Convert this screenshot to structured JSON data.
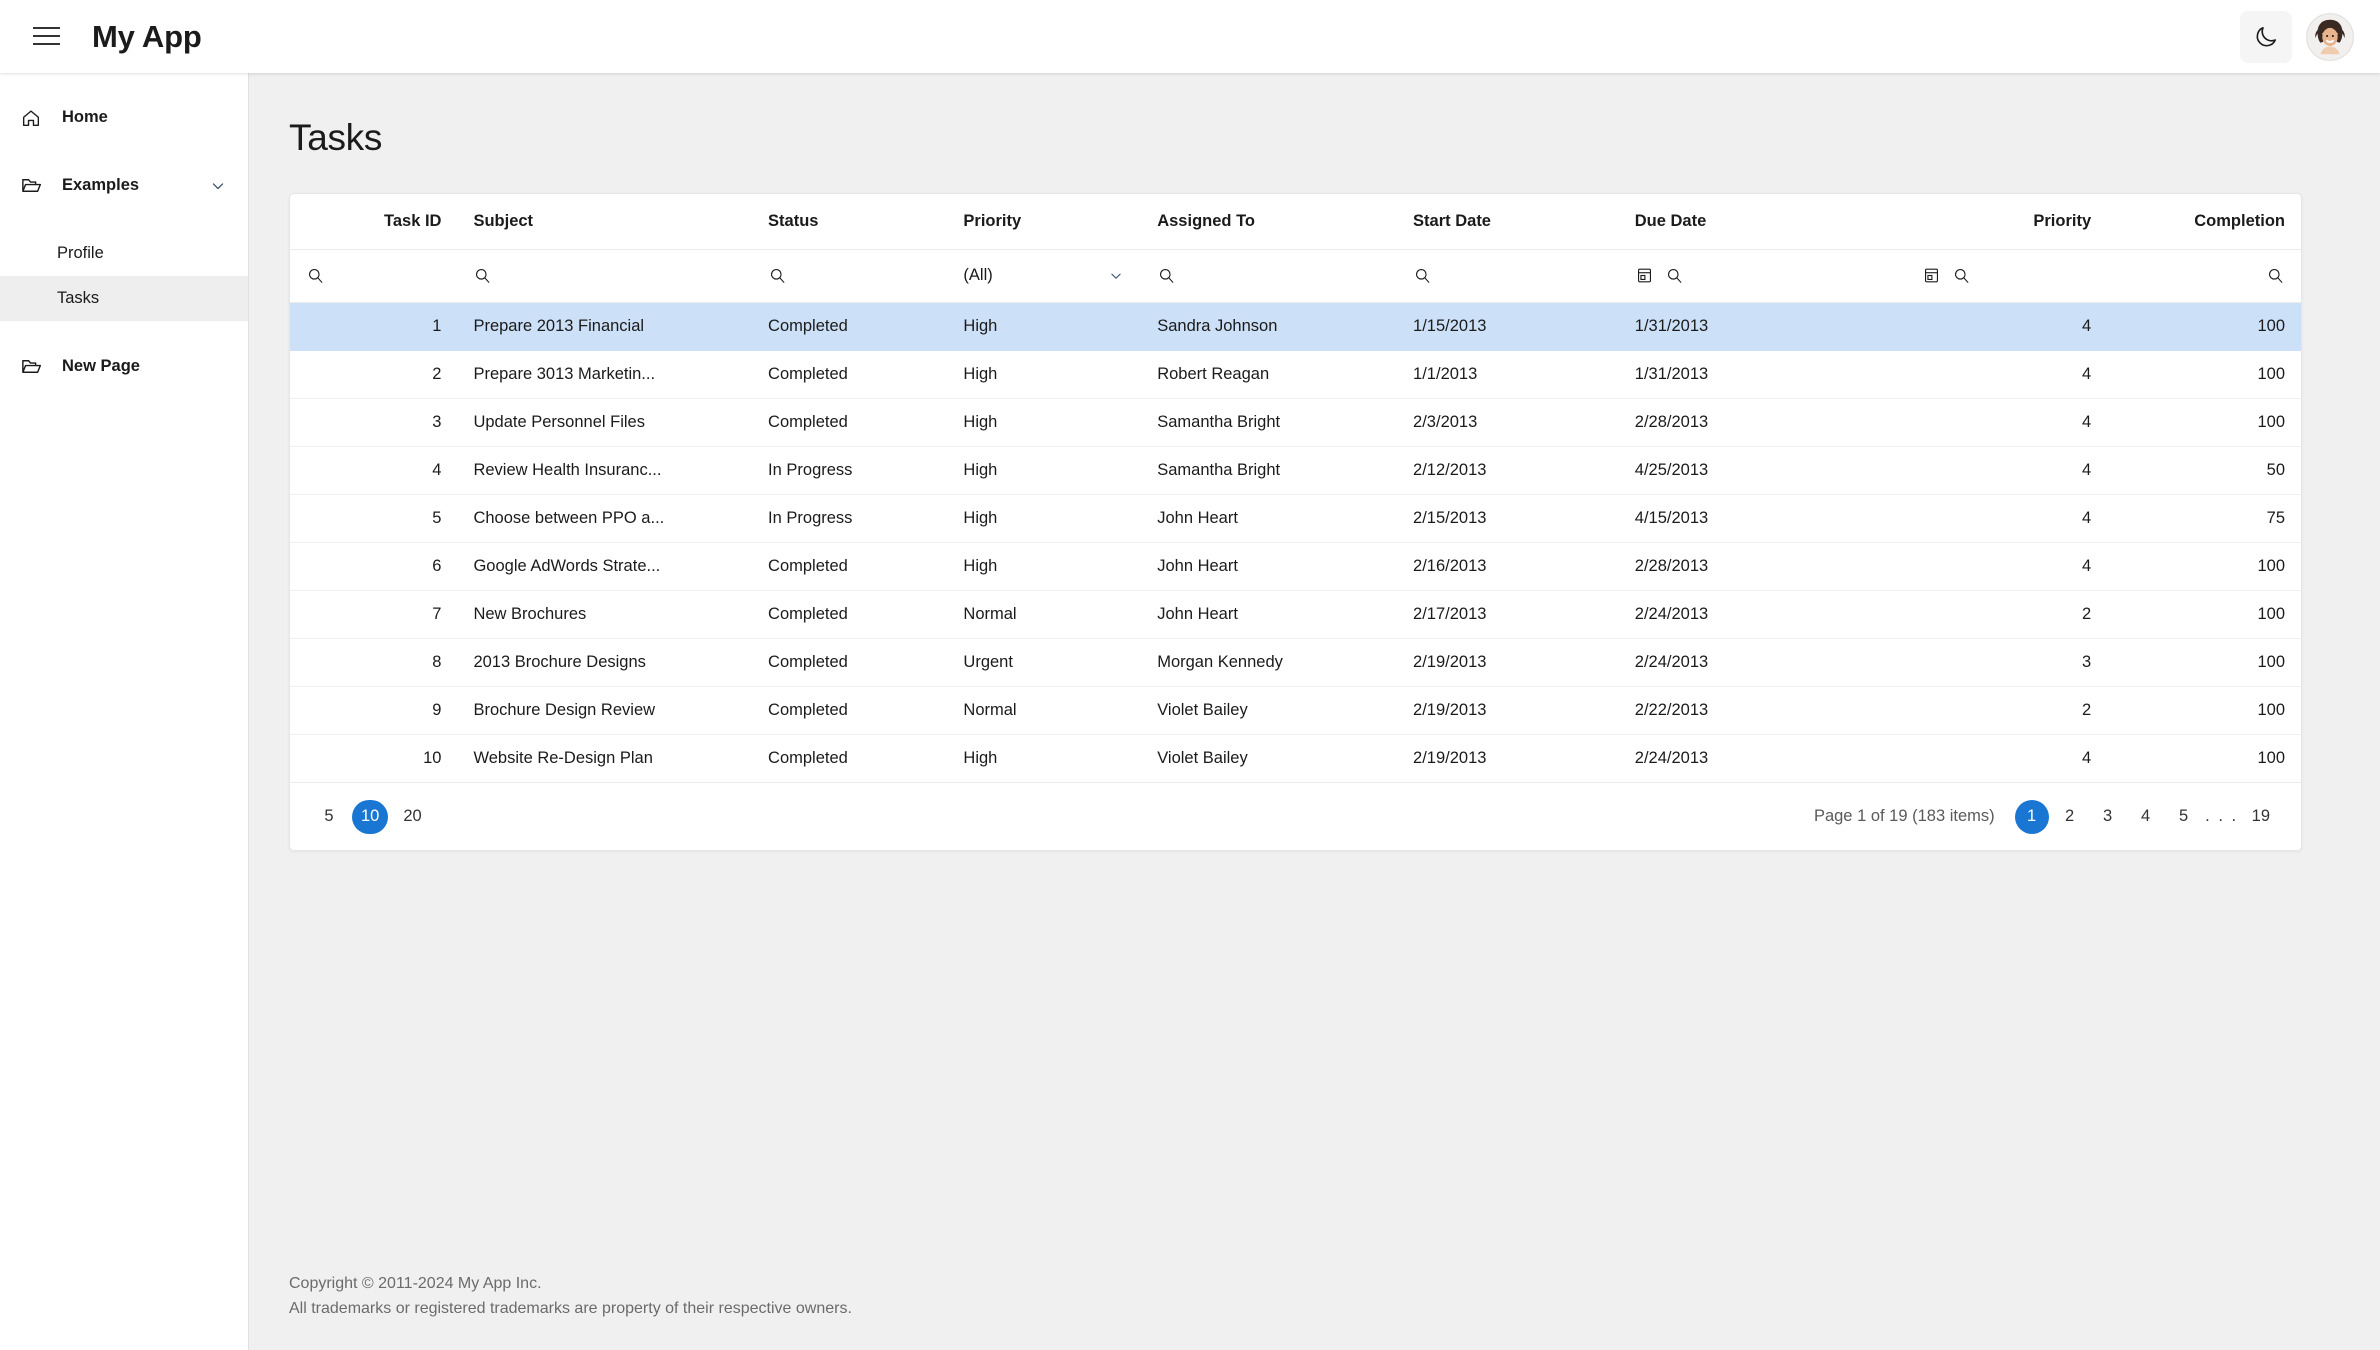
{
  "header": {
    "title": "My App",
    "menu_icon": "hamburger-menu-icon",
    "theme_icon": "moon-icon",
    "avatar": "user-avatar"
  },
  "sidebar": {
    "items": [
      {
        "label": "Home",
        "icon": "home-icon",
        "level": 1,
        "bold": true,
        "active": false,
        "expandable": false
      },
      {
        "label": "Examples",
        "icon": "folder-icon",
        "level": 1,
        "bold": true,
        "active": false,
        "expandable": true
      },
      {
        "label": "Profile",
        "icon": "",
        "level": 2,
        "bold": false,
        "active": false,
        "expandable": false
      },
      {
        "label": "Tasks",
        "icon": "",
        "level": 2,
        "bold": false,
        "active": true,
        "expandable": false
      },
      {
        "label": "New Page",
        "icon": "folder-icon",
        "level": 1,
        "bold": true,
        "active": false,
        "expandable": false
      }
    ]
  },
  "main": {
    "page_title": "Tasks",
    "grid": {
      "columns": [
        {
          "key": "task_id",
          "label": "Task ID",
          "align": "right"
        },
        {
          "key": "subject",
          "label": "Subject",
          "align": "left"
        },
        {
          "key": "status",
          "label": "Status",
          "align": "left"
        },
        {
          "key": "priority",
          "label": "Priority",
          "align": "left"
        },
        {
          "key": "assigned_to",
          "label": "Assigned To",
          "align": "left"
        },
        {
          "key": "start_date",
          "label": "Start Date",
          "align": "left"
        },
        {
          "key": "due_date",
          "label": "Due Date",
          "align": "left"
        },
        {
          "key": "priority_n",
          "label": "Priority",
          "align": "right"
        },
        {
          "key": "completion",
          "label": "Completion",
          "align": "right"
        }
      ],
      "filter_row": [
        {
          "type": "search",
          "icon": "search-icon"
        },
        {
          "type": "search",
          "icon": "search-icon"
        },
        {
          "type": "search",
          "icon": "search-icon"
        },
        {
          "type": "select",
          "value": "(All)",
          "icon": "chevron-down-icon"
        },
        {
          "type": "search",
          "icon": "search-icon"
        },
        {
          "type": "search",
          "icon": "search-icon"
        },
        {
          "type": "date",
          "icon": "calendar-icon",
          "icon2": "search-icon"
        },
        {
          "type": "date",
          "icon": "calendar-icon",
          "icon2": "search-icon"
        },
        {
          "type": "search-right",
          "icon": "search-icon"
        }
      ],
      "rows": [
        {
          "task_id": "1",
          "subject": "Prepare 2013 Financial",
          "status": "Completed",
          "priority": "High",
          "assigned_to": "Sandra Johnson",
          "start_date": "1/15/2013",
          "due_date": "1/31/2013",
          "priority_n": "4",
          "completion": "100",
          "selected": true
        },
        {
          "task_id": "2",
          "subject": "Prepare 3013 Marketin...",
          "status": "Completed",
          "priority": "High",
          "assigned_to": "Robert Reagan",
          "start_date": "1/1/2013",
          "due_date": "1/31/2013",
          "priority_n": "4",
          "completion": "100",
          "selected": false
        },
        {
          "task_id": "3",
          "subject": "Update Personnel Files",
          "status": "Completed",
          "priority": "High",
          "assigned_to": "Samantha Bright",
          "start_date": "2/3/2013",
          "due_date": "2/28/2013",
          "priority_n": "4",
          "completion": "100",
          "selected": false
        },
        {
          "task_id": "4",
          "subject": "Review Health Insuranc...",
          "status": "In Progress",
          "priority": "High",
          "assigned_to": "Samantha Bright",
          "start_date": "2/12/2013",
          "due_date": "4/25/2013",
          "priority_n": "4",
          "completion": "50",
          "selected": false
        },
        {
          "task_id": "5",
          "subject": "Choose between PPO a...",
          "status": "In Progress",
          "priority": "High",
          "assigned_to": "John Heart",
          "start_date": "2/15/2013",
          "due_date": "4/15/2013",
          "priority_n": "4",
          "completion": "75",
          "selected": false
        },
        {
          "task_id": "6",
          "subject": "Google AdWords Strate...",
          "status": "Completed",
          "priority": "High",
          "assigned_to": "John Heart",
          "start_date": "2/16/2013",
          "due_date": "2/28/2013",
          "priority_n": "4",
          "completion": "100",
          "selected": false
        },
        {
          "task_id": "7",
          "subject": "New Brochures",
          "status": "Completed",
          "priority": "Normal",
          "assigned_to": "John Heart",
          "start_date": "2/17/2013",
          "due_date": "2/24/2013",
          "priority_n": "2",
          "completion": "100",
          "selected": false
        },
        {
          "task_id": "8",
          "subject": "2013 Brochure Designs",
          "status": "Completed",
          "priority": "Urgent",
          "assigned_to": "Morgan Kennedy",
          "start_date": "2/19/2013",
          "due_date": "2/24/2013",
          "priority_n": "3",
          "completion": "100",
          "selected": false
        },
        {
          "task_id": "9",
          "subject": "Brochure Design Review",
          "status": "Completed",
          "priority": "Normal",
          "assigned_to": "Violet Bailey",
          "start_date": "2/19/2013",
          "due_date": "2/22/2013",
          "priority_n": "2",
          "completion": "100",
          "selected": false
        },
        {
          "task_id": "10",
          "subject": "Website Re-Design Plan",
          "status": "Completed",
          "priority": "High",
          "assigned_to": "Violet Bailey",
          "start_date": "2/19/2013",
          "due_date": "2/24/2013",
          "priority_n": "4",
          "completion": "100",
          "selected": false
        }
      ],
      "pager": {
        "page_sizes": [
          {
            "label": "5",
            "selected": false
          },
          {
            "label": "10",
            "selected": true
          },
          {
            "label": "20",
            "selected": false
          }
        ],
        "info": "Page 1 of 19 (183 items)",
        "pages": [
          {
            "label": "1",
            "selected": true,
            "dots": false
          },
          {
            "label": "2",
            "selected": false,
            "dots": false
          },
          {
            "label": "3",
            "selected": false,
            "dots": false
          },
          {
            "label": "4",
            "selected": false,
            "dots": false
          },
          {
            "label": "5",
            "selected": false,
            "dots": false
          },
          {
            "label": ". . .",
            "selected": false,
            "dots": true
          },
          {
            "label": "19",
            "selected": false,
            "dots": false
          }
        ]
      }
    }
  },
  "footer": {
    "line1": "Copyright © 2011-2024 My App Inc.",
    "line2": "All trademarks or registered trademarks are property of their respective owners."
  },
  "colors": {
    "accent": "#1976d2",
    "selected_row": "#cce0f7",
    "content_bg": "#f0f0f0",
    "sidebar_active": "#eeeeee"
  }
}
